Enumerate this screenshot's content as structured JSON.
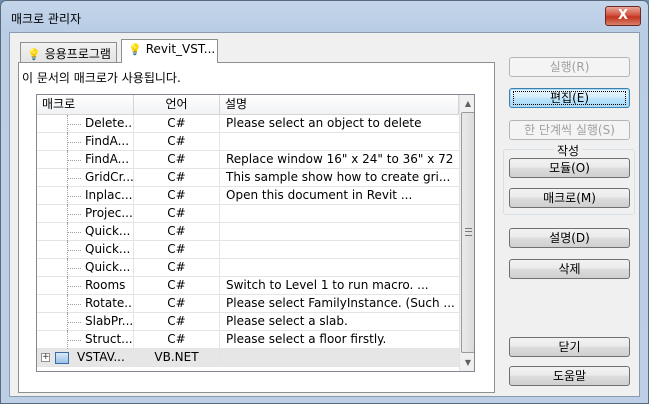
{
  "window": {
    "title": "매크로 관리자",
    "close_label": "X"
  },
  "tabs": [
    {
      "label": "응용프로그램",
      "active": false
    },
    {
      "label": "Revit_VST...",
      "active": true
    }
  ],
  "panel": {
    "caption": "이 문서의 매크로가 사용됩니다."
  },
  "grid": {
    "columns": [
      "매크로",
      "언어",
      "설명"
    ],
    "rows": [
      {
        "name": "Delete...",
        "lang": "C#",
        "desc": "Please select an object to delete"
      },
      {
        "name": "FindA...",
        "lang": "C#",
        "desc": ""
      },
      {
        "name": "FindA...",
        "lang": "C#",
        "desc": "Replace window 16\" x 24\" to 36\" x 72"
      },
      {
        "name": "GridCr...",
        "lang": "C#",
        "desc": "This sample show how to create gri..."
      },
      {
        "name": "Inplac...",
        "lang": "C#",
        "desc": "Open this document in Revit ..."
      },
      {
        "name": "Projec...",
        "lang": "C#",
        "desc": ""
      },
      {
        "name": "Quick...",
        "lang": "C#",
        "desc": ""
      },
      {
        "name": "Quick...",
        "lang": "C#",
        "desc": ""
      },
      {
        "name": "Quick...",
        "lang": "C#",
        "desc": ""
      },
      {
        "name": "Rooms",
        "lang": "C#",
        "desc": "Switch to Level 1 to run macro. ..."
      },
      {
        "name": "Rotate...",
        "lang": "C#",
        "desc": "Please select FamilyInstance. (Such ..."
      },
      {
        "name": "SlabPr...",
        "lang": "C#",
        "desc": "Please select a slab."
      },
      {
        "name": "Struct...",
        "lang": "C#",
        "desc": "Please select a floor firstly."
      }
    ],
    "project_row": {
      "expander": "+",
      "name": "VSTAV...",
      "lang": "VB.NET",
      "desc": ""
    },
    "scroll_up": "▲",
    "scroll_down": "▼"
  },
  "buttons": {
    "run": "실행(R)",
    "edit": "편집(E)",
    "step": "한 단계씩 실행(S)",
    "create_group": "작성",
    "module": "모듈(O)",
    "macro": "매크로(M)",
    "description": "설명(D)",
    "delete": "삭제",
    "close": "닫기",
    "help": "도움말"
  },
  "colors": {
    "title_bar": "#b9cde5",
    "close_button": "#c2341f",
    "default_button": "#3c7fb1",
    "project_row_bg": "#e6e6e6"
  },
  "icons": {
    "tab_icon": "lightbulb-icon",
    "project_icon": "project-icon"
  }
}
